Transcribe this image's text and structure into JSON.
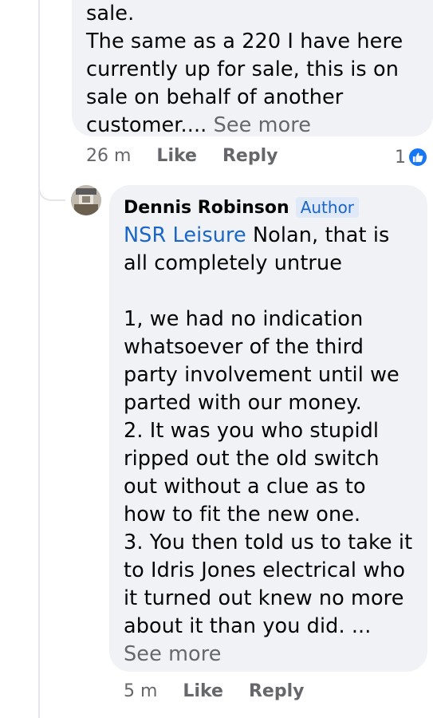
{
  "parent_comment": {
    "text_lines": "sale.\nThe same as a 220 I have here\ncurrently up for sale, this is on\nsale on behalf of another\ncustomer.... ",
    "see_more": "See more",
    "time": "26 m",
    "like_label": "Like",
    "reply_label": "Reply",
    "reaction_count": "1",
    "reaction_icon": "like-icon"
  },
  "reply_comment": {
    "author": "Dennis Robinson",
    "badge": "Author",
    "mention": "NSR Leisure",
    "text_after_mention": " Nolan, that is\nall completely untrue\n\n1, we had no indication\nwhatsoever of the third\nparty involvement until we\nparted with our money.\n2. It was you who stupidl\nripped out the old switch\nout without a clue as to\nhow to fit the new one.\n3. You then told us to take it\nto Idris Jones electrical who\nit turned out knew no more\nabout it than you did. ...\n",
    "see_more": "See more",
    "time": "5 m",
    "like_label": "Like",
    "reply_label": "Reply"
  },
  "colors": {
    "bubble": "#f0f2f5",
    "link_blue": "#1a66c8",
    "meta_gray": "#65676b",
    "like_blue": "#1877f2"
  }
}
